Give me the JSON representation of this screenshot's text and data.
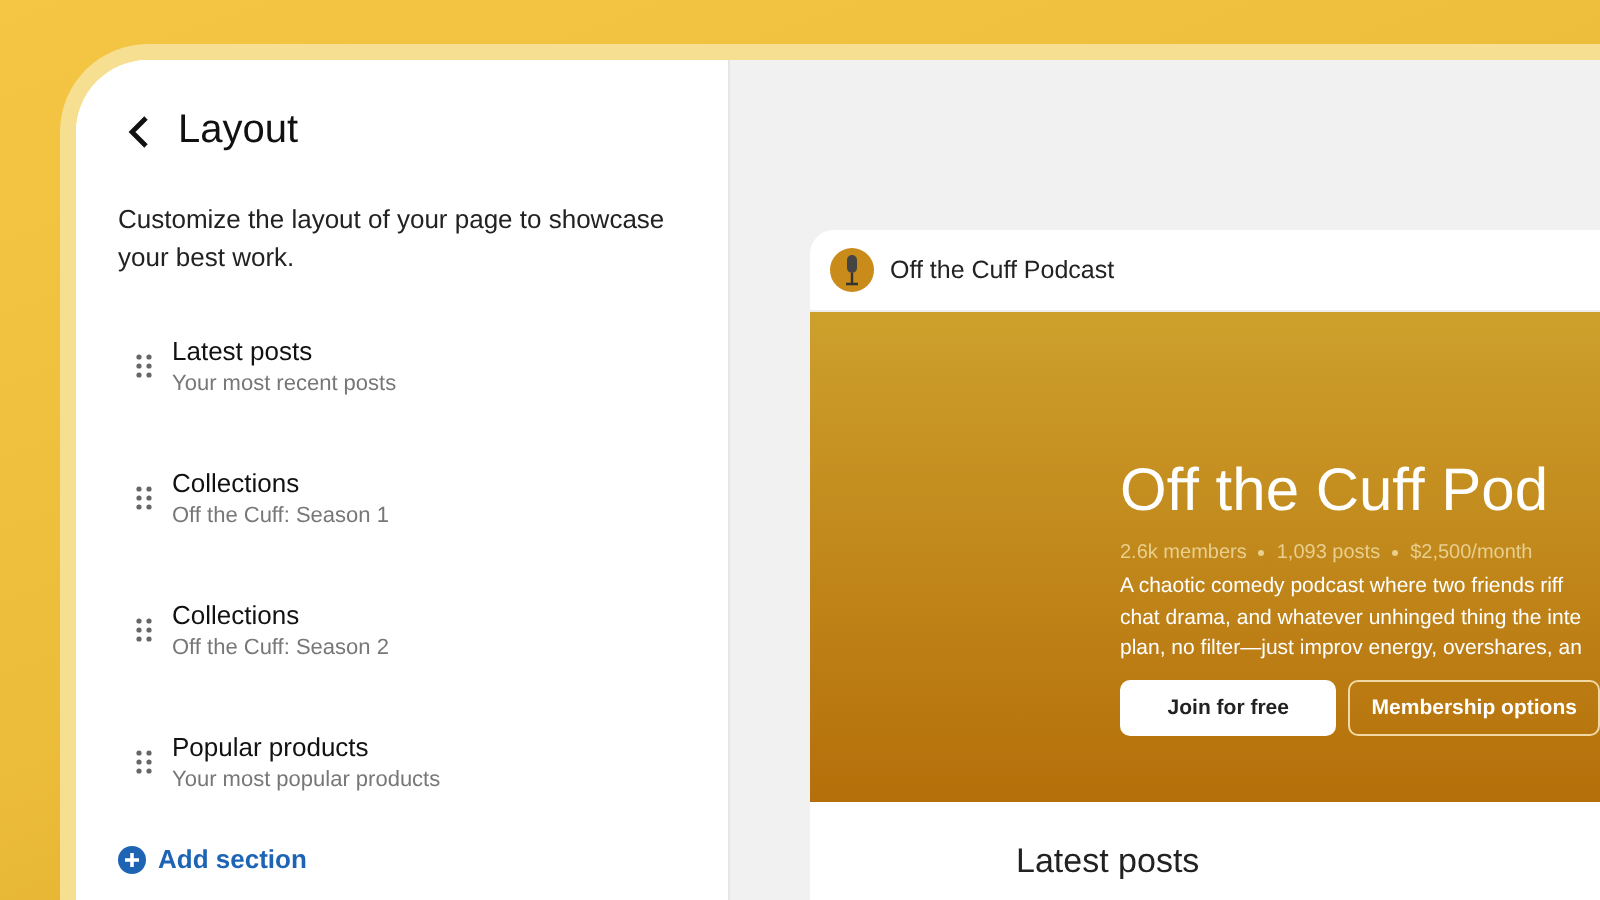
{
  "panel": {
    "title": "Layout",
    "description": "Customize the layout of your page to showcase your best work.",
    "sections": [
      {
        "title": "Latest posts",
        "subtitle": "Your most recent posts"
      },
      {
        "title": "Collections",
        "subtitle": "Off the Cuff: Season 1"
      },
      {
        "title": "Collections",
        "subtitle": "Off the Cuff: Season 2"
      },
      {
        "title": "Popular products",
        "subtitle": "Your most popular products"
      }
    ],
    "add_button": "Add section"
  },
  "preview": {
    "page_name": "Off the Cuff Podcast",
    "hero_title": "Off the Cuff Pod",
    "stats": [
      "2.6k members",
      "1,093 posts",
      "$2,500/month"
    ],
    "description_lines": [
      "A chaotic comedy podcast where two friends riff",
      "chat drama, and whatever unhinged thing the inte",
      "plan, no filter—just improv energy, overshares, an"
    ],
    "buttons": [
      {
        "label": "Join for free",
        "kind": "primary"
      },
      {
        "label": "Membership options",
        "kind": "outline"
      }
    ],
    "section_heading": "Latest posts"
  }
}
